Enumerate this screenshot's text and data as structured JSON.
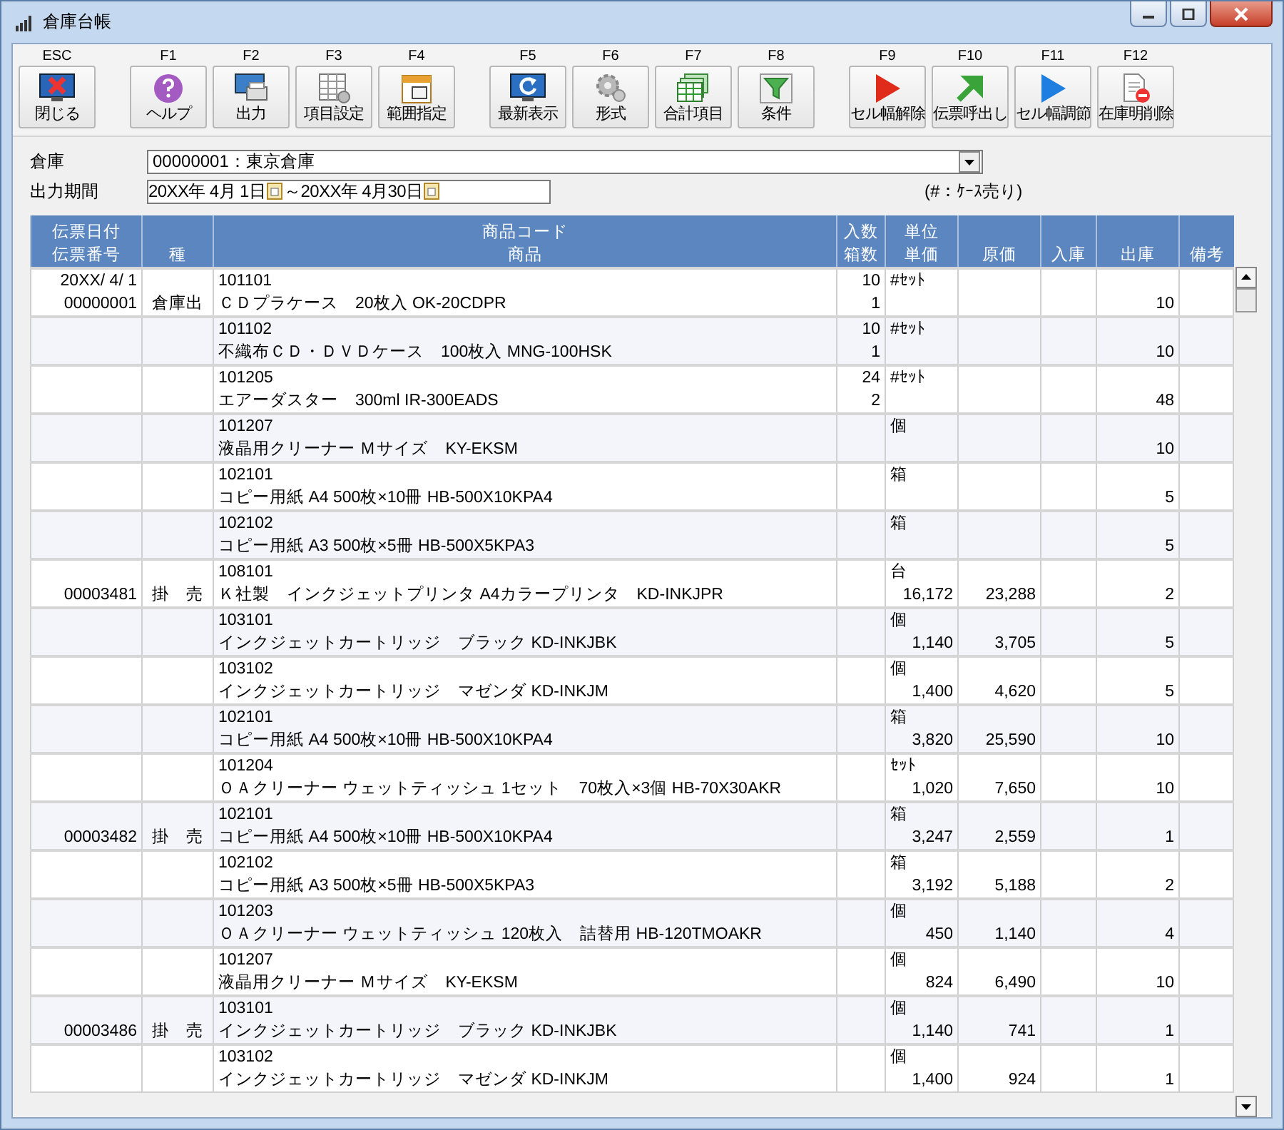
{
  "window": {
    "title": "倉庫台帳"
  },
  "toolbar": [
    {
      "key": "ESC",
      "label": "閉じる"
    },
    {
      "key": "F1",
      "label": "ヘルプ"
    },
    {
      "key": "F2",
      "label": "出力"
    },
    {
      "key": "F3",
      "label": "項目設定"
    },
    {
      "key": "F4",
      "label": "範囲指定"
    },
    {
      "key": "F5",
      "label": "最新表示"
    },
    {
      "key": "F6",
      "label": "形式"
    },
    {
      "key": "F7",
      "label": "合計項目"
    },
    {
      "key": "F8",
      "label": "条件"
    },
    {
      "key": "F9",
      "label": "セル幅解除"
    },
    {
      "key": "F10",
      "label": "伝票呼出し"
    },
    {
      "key": "F11",
      "label": "セル幅調節"
    },
    {
      "key": "F12",
      "label": "在庫明削除"
    }
  ],
  "form": {
    "warehouse": {
      "label": "倉庫",
      "value": "00000001：東京倉庫"
    },
    "period": {
      "label": "出力期間",
      "from": "20XX年 4月 1日",
      "to": "～20XX年 4月30日"
    },
    "note": "(#：ｹｰｽ売り)"
  },
  "table": {
    "columns": [
      {
        "lines": [
          "伝票日付",
          "伝票番号"
        ]
      },
      {
        "lines": [
          "種"
        ]
      },
      {
        "lines": [
          "商品コード",
          "商品"
        ]
      },
      {
        "lines": [
          "入数",
          "箱数"
        ]
      },
      {
        "lines": [
          "単位",
          "単価"
        ]
      },
      {
        "lines": [
          "原価"
        ]
      },
      {
        "lines": [
          "入庫"
        ]
      },
      {
        "lines": [
          "出庫"
        ]
      },
      {
        "lines": [
          "備考"
        ]
      }
    ],
    "rows": [
      {
        "date": "20XX/ 4/ 1",
        "number": "00000001",
        "kind": "倉庫出",
        "code": "101101",
        "name": "ＣＤプラケース　20枚入 OK-20CDPR",
        "per_case": "10",
        "cases": "1",
        "unit": "#ｾｯﾄ",
        "out": "10"
      },
      {
        "code": "101102",
        "name": "不織布ＣＤ・ＤＶＤケース　100枚入 MNG-100HSK",
        "per_case": "10",
        "cases": "1",
        "unit": "#ｾｯﾄ",
        "out": "10"
      },
      {
        "code": "101205",
        "name": "エアーダスター　300ml IR-300EADS",
        "per_case": "24",
        "cases": "2",
        "unit": "#ｾｯﾄ",
        "out": "48"
      },
      {
        "code": "101207",
        "name": "液晶用クリーナー Ｍサイズ　KY-EKSM",
        "unit": "個",
        "out": "10"
      },
      {
        "code": "102101",
        "name": "コピー用紙 A4 500枚×10冊 HB-500X10KPA4",
        "unit": "箱",
        "out": "5"
      },
      {
        "code": "102102",
        "name": "コピー用紙 A3 500枚×5冊 HB-500X5KPA3",
        "unit": "箱",
        "out": "5"
      },
      {
        "number": "00003481",
        "kind": "掛　売",
        "code": "108101",
        "name": "Ｋ社製　インクジェットプリンタ A4カラープリンタ　KD-INKJPR",
        "unit": "台",
        "price": "16,172",
        "cost": "23,288",
        "out": "2"
      },
      {
        "code": "103101",
        "name": "インクジェットカートリッジ　ブラック KD-INKJBK",
        "unit": "個",
        "price": "1,140",
        "cost": "3,705",
        "out": "5"
      },
      {
        "code": "103102",
        "name": "インクジェットカートリッジ　マゼンダ KD-INKJM",
        "unit": "個",
        "price": "1,400",
        "cost": "4,620",
        "out": "5"
      },
      {
        "code": "102101",
        "name": "コピー用紙 A4 500枚×10冊 HB-500X10KPA4",
        "unit": "箱",
        "price": "3,820",
        "cost": "25,590",
        "out": "10"
      },
      {
        "code": "101204",
        "name": "ＯＡクリーナー ウェットティッシュ 1セット　70枚入×3個 HB-70X30AKR",
        "unit": "ｾｯﾄ",
        "price": "1,020",
        "cost": "7,650",
        "out": "10"
      },
      {
        "number": "00003482",
        "kind": "掛　売",
        "code": "102101",
        "name": "コピー用紙 A4 500枚×10冊 HB-500X10KPA4",
        "unit": "箱",
        "price": "3,247",
        "cost": "2,559",
        "out": "1"
      },
      {
        "code": "102102",
        "name": "コピー用紙 A3 500枚×5冊 HB-500X5KPA3",
        "unit": "箱",
        "price": "3,192",
        "cost": "5,188",
        "out": "2"
      },
      {
        "code": "101203",
        "name": "ＯＡクリーナー ウェットティッシュ 120枚入　詰替用 HB-120TMOAKR",
        "unit": "個",
        "price": "450",
        "cost": "1,140",
        "out": "4"
      },
      {
        "code": "101207",
        "name": "液晶用クリーナー Ｍサイズ　KY-EKSM",
        "unit": "個",
        "price": "824",
        "cost": "6,490",
        "out": "10"
      },
      {
        "number": "00003486",
        "kind": "掛　売",
        "code": "103101",
        "name": "インクジェットカートリッジ　ブラック KD-INKJBK",
        "unit": "個",
        "price": "1,140",
        "cost": "741",
        "out": "1"
      },
      {
        "code": "103102",
        "name": "インクジェットカートリッジ　マゼンダ KD-INKJM",
        "unit": "個",
        "price": "1,400",
        "cost": "924",
        "out": "1"
      }
    ]
  }
}
